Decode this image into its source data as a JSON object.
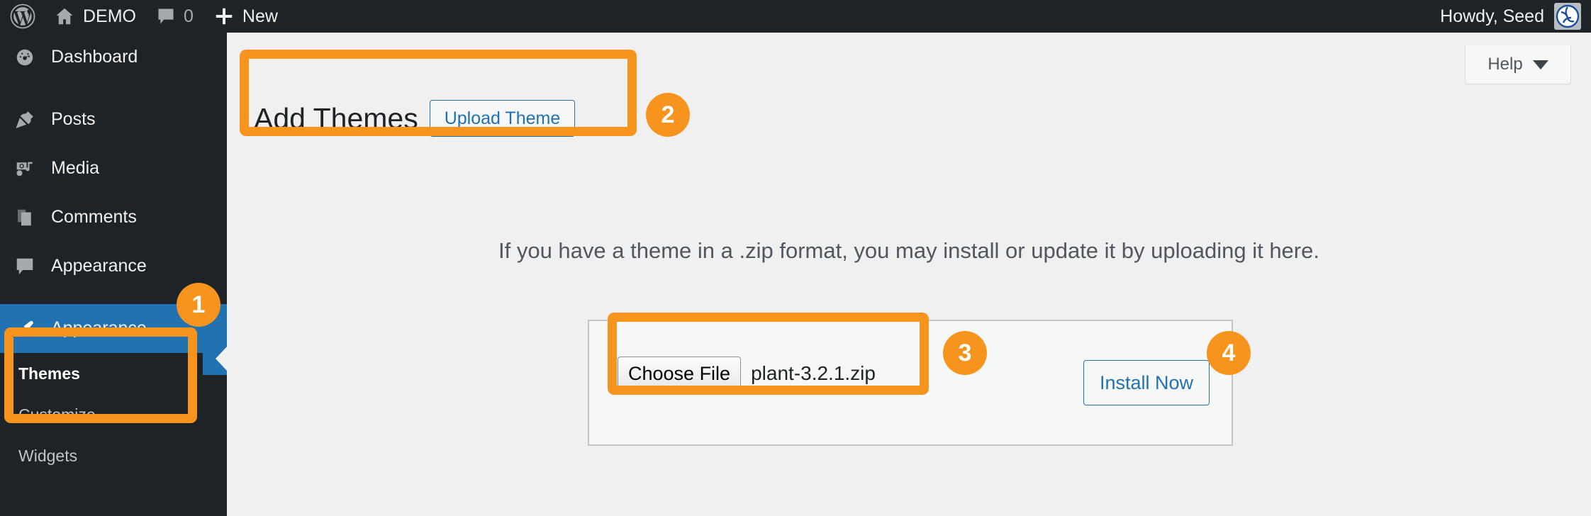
{
  "adminbar": {
    "wp_logo_icon": "wordpress-logo-icon",
    "site_home_icon": "home-icon",
    "site_name": "DEMO",
    "comments_icon": "comment-bubble-icon",
    "comments_count": "0",
    "new_icon": "plus-icon",
    "new_label": "New",
    "howdy": "Howdy, Seed",
    "avatar_icon": "user-avatar-icon"
  },
  "sidebar": {
    "items": [
      {
        "label": "Dashboard",
        "icon": "dashboard-gauge-icon",
        "active": false
      },
      {
        "label": "Posts",
        "icon": "pushpin-icon",
        "active": false
      },
      {
        "label": "Media",
        "icon": "media-camera-music-icon",
        "active": false
      },
      {
        "label": "Comments",
        "icon": "comment-bubble-icon",
        "active": false
      },
      {
        "label": "Appearance",
        "icon": "paintbrush-icon",
        "active": true
      }
    ],
    "submenu": [
      {
        "label": "Themes",
        "current": true
      },
      {
        "label": "Customize",
        "current": false
      },
      {
        "label": "Widgets",
        "current": false
      }
    ]
  },
  "content": {
    "help_label": "Help",
    "help_caret_icon": "chevron-down-icon",
    "page_title": "Add Themes",
    "upload_theme_label": "Upload Theme",
    "intro_text": "If you have a theme in a .zip format, you may install or update it by uploading it here.",
    "choose_file_label": "Choose File",
    "file_name": "plant-3.2.1.zip",
    "install_now_label": "Install Now"
  },
  "annotations": {
    "accent_color": "#F7941D",
    "badges": [
      {
        "number": "1",
        "target": "appearance-menu"
      },
      {
        "number": "2",
        "target": "upload-theme-button"
      },
      {
        "number": "3",
        "target": "choose-file-input"
      },
      {
        "number": "4",
        "target": "install-now-button"
      }
    ]
  },
  "colors": {
    "admin_dark": "#1d2327",
    "admin_blue": "#2271b1",
    "page_bg": "#f0f0f1",
    "accent_orange": "#F7941D"
  }
}
